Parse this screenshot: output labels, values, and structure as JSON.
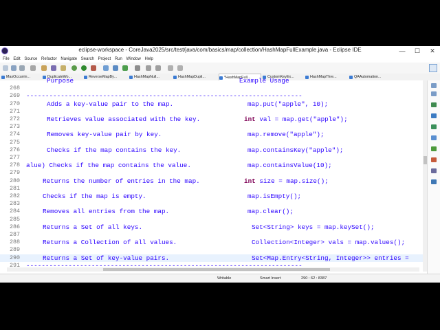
{
  "window": {
    "title": "eclipse-workspace - CoreJava2025/src/test/java/com/basics/map/collection/HashMapFullExample.java - Eclipse IDE",
    "minimize": "—",
    "maximize": "☐",
    "close": "✕"
  },
  "menu": [
    "File",
    "Edit",
    "Source",
    "Refactor",
    "Navigate",
    "Search",
    "Project",
    "Run",
    "Window",
    "Help"
  ],
  "tabs": [
    {
      "label": "MaxOccurrin...",
      "active": false
    },
    {
      "label": "DuplicateWo...",
      "active": false
    },
    {
      "label": "ReverseMapBy...",
      "active": false
    },
    {
      "label": "HashMapNull...",
      "active": false
    },
    {
      "label": "HashMapDupli...",
      "active": false
    },
    {
      "label": "*HashMapFull...",
      "active": true
    },
    {
      "label": "CustomKeyEx...",
      "active": false
    },
    {
      "label": "HashMapThre...",
      "active": false
    },
    {
      "label": "QAAutomation...",
      "active": false
    }
  ],
  "editor": {
    "lines": [
      {
        "n": "",
        "a": "Purpose",
        "b": "Example Usage",
        "partial": true
      },
      {
        "n": "268",
        "a": "",
        "b": ""
      },
      {
        "n": "269",
        "dash": "------------------------------------------------------------------------"
      },
      {
        "n": "270",
        "a": "Adds a key-value pair to the map.",
        "b": "map.put(\"apple\", 10);"
      },
      {
        "n": "271",
        "a": "",
        "b": ""
      },
      {
        "n": "272",
        "a": "Retrieves value associated with the key.",
        "bkw": "int",
        "b": " val = map.get(\"apple\");"
      },
      {
        "n": "273",
        "a": "",
        "b": ""
      },
      {
        "n": "274",
        "a": "Removes key-value pair by key.",
        "b": "map.remove(\"apple\");"
      },
      {
        "n": "275",
        "a": "",
        "b": ""
      },
      {
        "n": "276",
        "a": "Checks if the map contains the key.",
        "b": "map.containsKey(\"apple\");"
      },
      {
        "n": "277",
        "a": "",
        "b": ""
      },
      {
        "n": "278",
        "a": "alue) Checks if the map contains the value.",
        "b": "map.containsValue(10);"
      },
      {
        "n": "279",
        "a": "",
        "b": ""
      },
      {
        "n": "280",
        "a": "Returns the number of entries in the map.",
        "bkw": "int",
        "b": " size = map.size();"
      },
      {
        "n": "281",
        "a": "",
        "b": ""
      },
      {
        "n": "282",
        "a": "Checks if the map is empty.",
        "b": "map.isEmpty();"
      },
      {
        "n": "283",
        "a": "",
        "b": ""
      },
      {
        "n": "284",
        "a": "Removes all entries from the map.",
        "b": "map.clear();"
      },
      {
        "n": "285",
        "a": "",
        "b": ""
      },
      {
        "n": "286",
        "a": "Returns a Set of all keys.",
        "b": "Set<String> keys = map.keySet();"
      },
      {
        "n": "287",
        "a": "",
        "b": ""
      },
      {
        "n": "288",
        "a": "Returns a Collection of all values.",
        "b": "Collection<Integer> vals = map.values();"
      },
      {
        "n": "289",
        "a": "",
        "b": ""
      },
      {
        "n": "290",
        "a": "Returns a Set of key-value pairs.",
        "b": "Set<Map.Entry<String, Integer>> entries =",
        "current": true
      },
      {
        "n": "291",
        "dash": "------------------------------------------------------------------------"
      }
    ]
  },
  "status": {
    "writable": "Writable",
    "insert_mode": "Smart Insert",
    "position": "290 : 62 : 8387"
  },
  "colors": {
    "comment": "#2a00ff",
    "keyword": "#7f0055",
    "line_numbers": "#787878",
    "current_line": "#e8f2fe"
  }
}
